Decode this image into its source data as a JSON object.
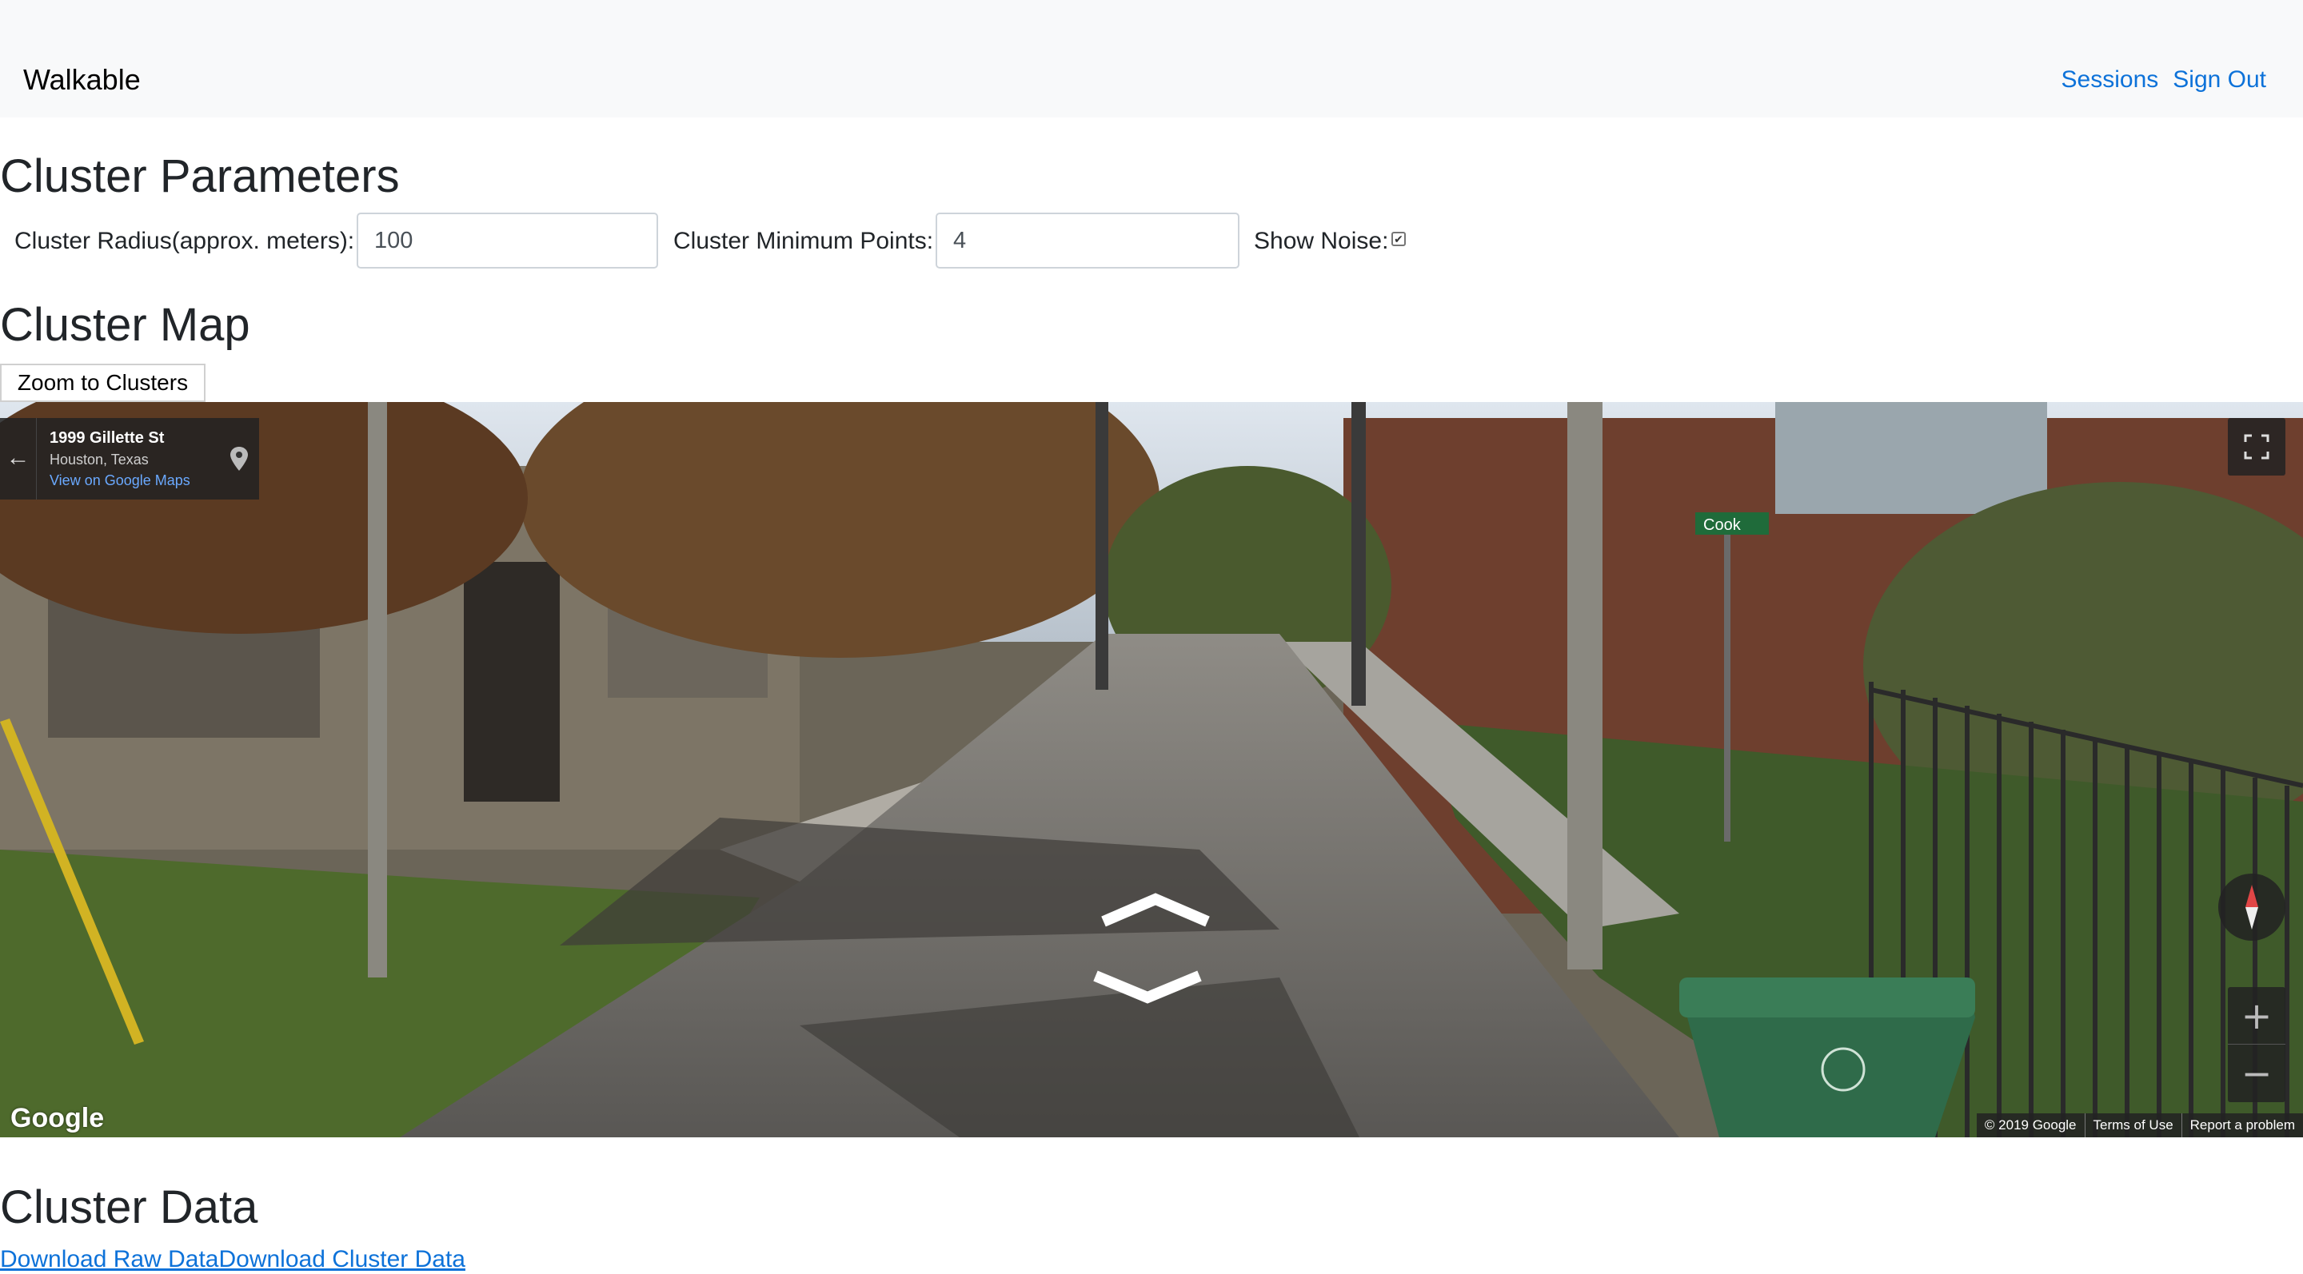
{
  "navbar": {
    "brand": "Walkable",
    "links": [
      "Sessions",
      "Sign Out"
    ]
  },
  "params": {
    "title": "Cluster Parameters",
    "radius_label": "Cluster Radius(approx. meters):",
    "radius_value": "100",
    "min_points_label": "Cluster Minimum Points:",
    "min_points_value": "4",
    "noise_label": "Show Noise:",
    "noise_checked": true
  },
  "map": {
    "title": "Cluster Map",
    "zoom_button": "Zoom to Clusters",
    "address_title": "1999 Gillette St",
    "address_sub": "Houston, Texas",
    "address_link": "View on Google Maps",
    "street_sign": "Cook",
    "logo": "Google",
    "attribution": [
      "© 2019 Google",
      "Terms of Use",
      "Report a problem"
    ]
  },
  "data_section": {
    "title": "Cluster Data",
    "link_raw": "Download Raw Data",
    "link_cluster": "Download Cluster Data"
  },
  "colors": {
    "link": "#0d72d9",
    "navbar_bg": "#f8f9fa"
  }
}
